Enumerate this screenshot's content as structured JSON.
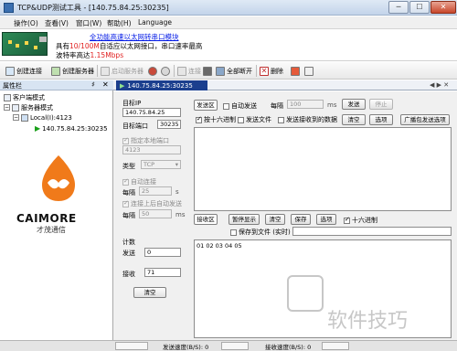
{
  "window": {
    "title": "TCP&UDP测试工具 - [140.75.84.25:30235]",
    "min_glyph": "─",
    "max_glyph": "☐",
    "close_glyph": "✕"
  },
  "menu": [
    "操作(O)",
    "查看(V)",
    "窗口(W)",
    "帮助(H)",
    "Language"
  ],
  "banner": {
    "link": "全功能高速以太网转串口模块",
    "line2_pre": "具有",
    "line2_red": "10/100M",
    "line2_post": "自适应以太网接口，串口速率最高",
    "line3_pre": "波特率高达",
    "line3_red": "1.15Mbps"
  },
  "toolbar": {
    "create_connection": "创建连接",
    "create_server": "创建服务器",
    "start_server": "启动服务器",
    "connect": "连接",
    "disconnect_all": "全部断开",
    "delete": "删除"
  },
  "left_panel": {
    "title": "属性栏",
    "pin": "♯",
    "close": "✕",
    "tree": {
      "client_mode": "客户端模式",
      "server_mode": "服务器模式",
      "local": "Local(I):4123",
      "remote": "140.75.84.25:30235"
    },
    "logo_text": "CAIMORE",
    "logo_cn": "才茂通信"
  },
  "tab": {
    "label": "140.75.84.25:30235",
    "nav": "◀ ▶ ✕"
  },
  "conn": {
    "target_ip_label": "目标IP",
    "target_ip": "140.75.84.25",
    "target_port_label": "目标端口",
    "target_port": "30235",
    "local_port_opt": "指定本地端口",
    "local_port": "4123",
    "type_label": "类型",
    "type_value": "TCP",
    "auto_connect": "自动连接",
    "every_label": "每隔",
    "every_value": "25",
    "every_unit": "s",
    "reconnect": "连接上后自动发送",
    "every2_label": "每隔",
    "every2_value": "50",
    "every2_unit": "ms"
  },
  "count": {
    "title": "计数",
    "send_label": "发送",
    "send_value": "0",
    "recv_label": "接收",
    "recv_value": "71",
    "clear": "清空"
  },
  "send": {
    "area_label": "发送区",
    "auto_send": "自动发送",
    "interval_label": "每隔",
    "interval_value": "100",
    "interval_unit": "ms",
    "send_btn": "发送",
    "stop_btn": "停止",
    "hex_send": "按十六进制",
    "send_file": "发送文件",
    "send_after_recv": "发送接收到的数据",
    "clear_btn": "清空",
    "options_btn": "选项",
    "broadcast_btn": "广播包发送选项"
  },
  "recv": {
    "area_label": "接收区",
    "pause_btn": "暂停显示",
    "clear_btn": "清空",
    "save_btn": "保存",
    "options_btn": "选项",
    "hex_label": "十六进制",
    "save_file": "保存到文件 (实时)",
    "data": "01 02 03 04 05"
  },
  "status": {
    "send_speed": "发送速度(B/S): 0",
    "recv_speed": "接收速度(B/S): 0"
  },
  "watermark": "软件技巧",
  "colors": {
    "tab_active": "#1b3f8e",
    "link": "#0018e6",
    "red": "#e02020",
    "logo_orange": "#f07a1a"
  }
}
